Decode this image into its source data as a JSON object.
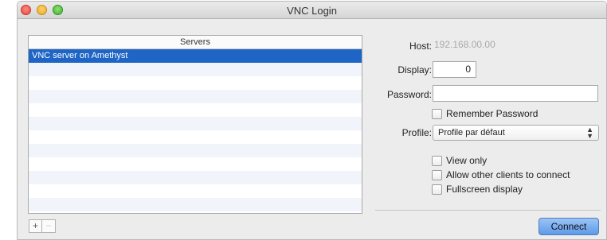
{
  "window": {
    "title": "VNC Login"
  },
  "servers": {
    "header": "Servers",
    "items": [
      "VNC server on Amethyst"
    ],
    "add_label": "+",
    "remove_label": "−"
  },
  "form": {
    "host_label": "Host:",
    "host_value": "192.168.00.00",
    "display_label": "Display:",
    "display_value": "0",
    "password_label": "Password:",
    "password_value": "",
    "remember_label": "Remember Password",
    "profile_label": "Profile:",
    "profile_value": "Profile par défaut",
    "view_only_label": "View only",
    "allow_others_label": "Allow other clients to connect",
    "fullscreen_label": "Fullscreen display"
  },
  "connect_label": "Connect"
}
